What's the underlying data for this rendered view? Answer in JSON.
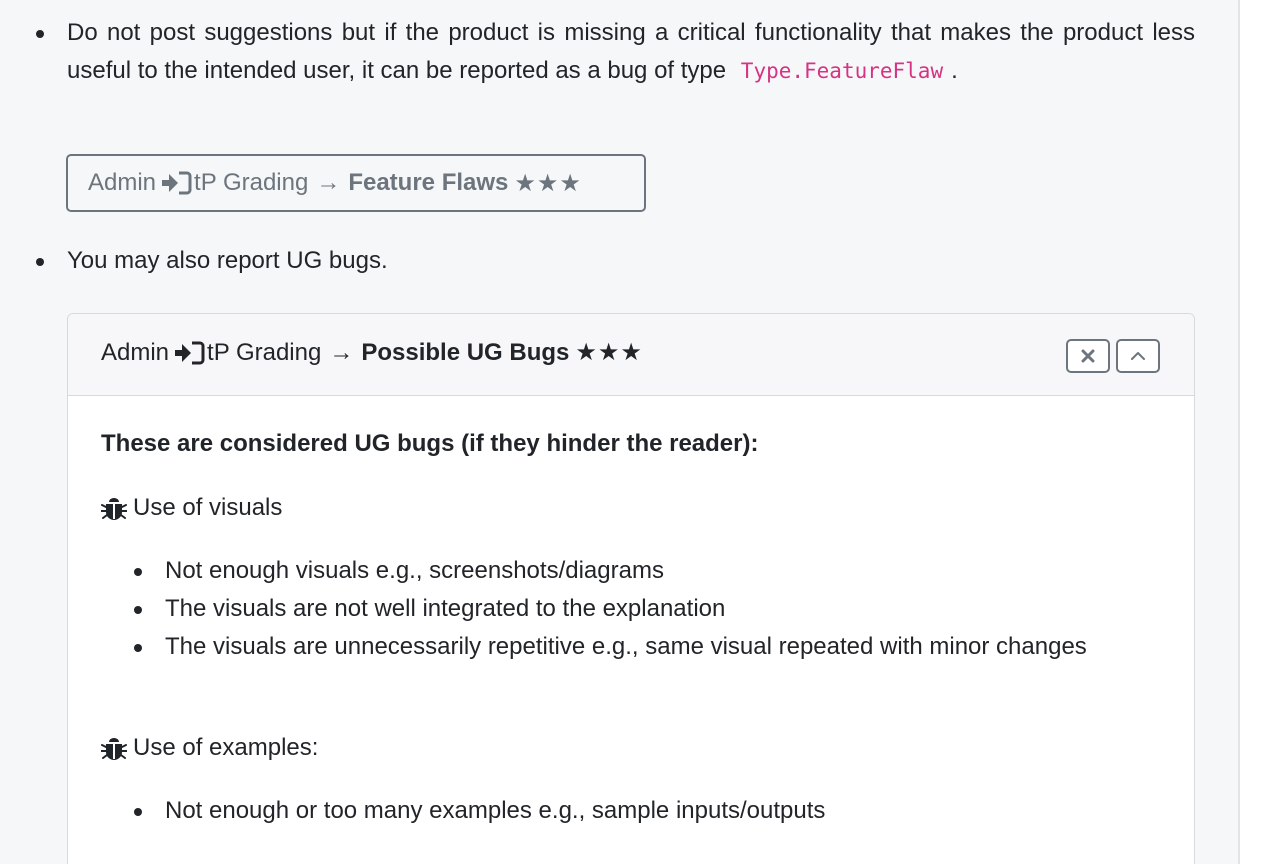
{
  "bullets": {
    "item1_text": "Do not post suggestions but if the product is missing a critical functionality that makes the product less useful to the intended user, it can be reported as a bug of type",
    "item1_code": "Type.FeatureFlaw",
    "item1_end": ".",
    "item2_text": "You may also report UG bugs."
  },
  "feature_panel": {
    "admin": "Admin",
    "grading": "tP Grading",
    "arrow": "→",
    "title": "Feature Flaws",
    "stars": "★★★",
    "state": "collapsed"
  },
  "ug_panel": {
    "admin": "Admin",
    "grading": "tP Grading",
    "arrow": "→",
    "title": "Possible UG Bugs",
    "stars": "★★★",
    "state": "expanded",
    "close_icon": "close-icon",
    "collapse_icon": "chevron-up-icon",
    "body_title": "These are considered UG bugs (if they hinder the reader):",
    "sections": [
      {
        "title": "Use of visuals",
        "items": [
          "Not enough visuals e.g., screenshots/diagrams",
          "The visuals are not well integrated to the explanation",
          "The visuals are unnecessarily repetitive e.g., same visual repeated with minor changes"
        ]
      },
      {
        "title": "Use of examples:",
        "items": [
          "Not enough or too many examples e.g., sample inputs/outputs"
        ]
      }
    ]
  },
  "colors": {
    "background": "#f6f7f9",
    "code": "#d63384",
    "muted": "#6c757d",
    "text": "#212529"
  }
}
